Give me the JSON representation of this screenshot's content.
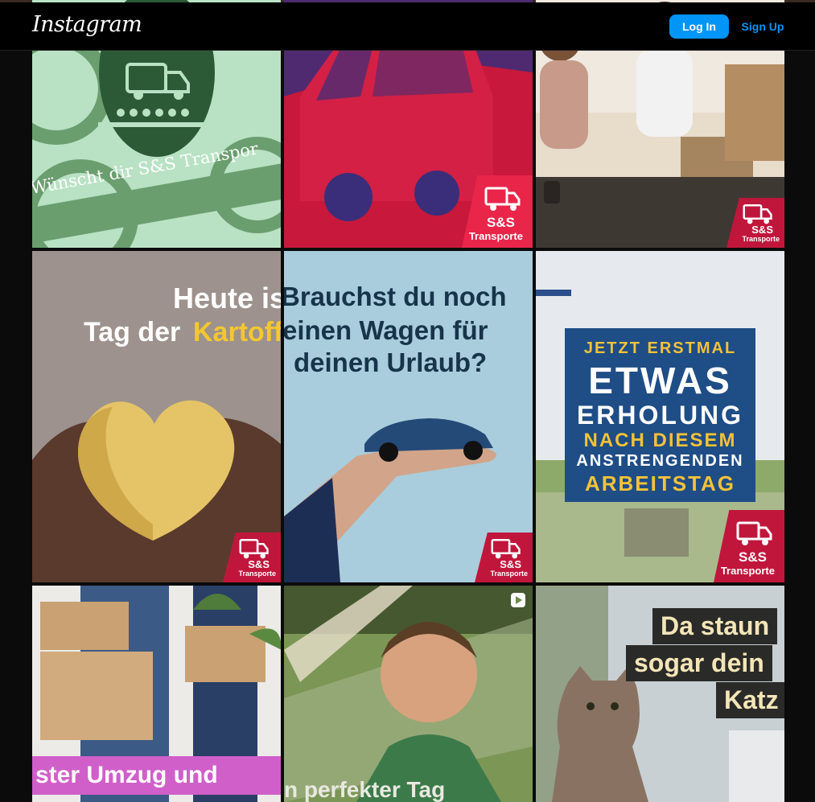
{
  "header": {
    "logo": "Instagram",
    "login_label": "Log In",
    "signup_label": "Sign Up"
  },
  "posts": [
    {
      "caption_line": "Wünscht dir S&S Transpor",
      "badge_top": "",
      "badge_bottom": ""
    },
    {
      "caption_line": "",
      "badge_top": "S&S",
      "badge_bottom": "Transporte"
    },
    {
      "caption_line": "",
      "badge_top": "S&S",
      "badge_bottom": "Transporte"
    },
    {
      "lines": [
        "Heute is",
        "Tag der",
        "Kartoffe"
      ],
      "badge_top": "S&S",
      "badge_bottom": "Transporte"
    },
    {
      "lines": [
        "Brauchst du noch",
        "einen Wagen für",
        "deinen Urlaub?"
      ],
      "badge_top": "S&S",
      "badge_bottom": "Transporte"
    },
    {
      "lines": [
        "JETZT ERSTMAL",
        "ETWAS",
        "ERHOLUNG",
        "NACH DIESEM",
        "ANSTRENGENDEN",
        "ARBEITSTAG"
      ],
      "badge_top": "S&S",
      "badge_bottom": "Transporte"
    },
    {
      "caption_line": "ster Umzug und"
    },
    {
      "caption_line": "n perfekter Tag",
      "media_type_icon": "play-icon"
    },
    {
      "lines": [
        "Da staun",
        "sogar dein",
        "Katz"
      ]
    }
  ]
}
